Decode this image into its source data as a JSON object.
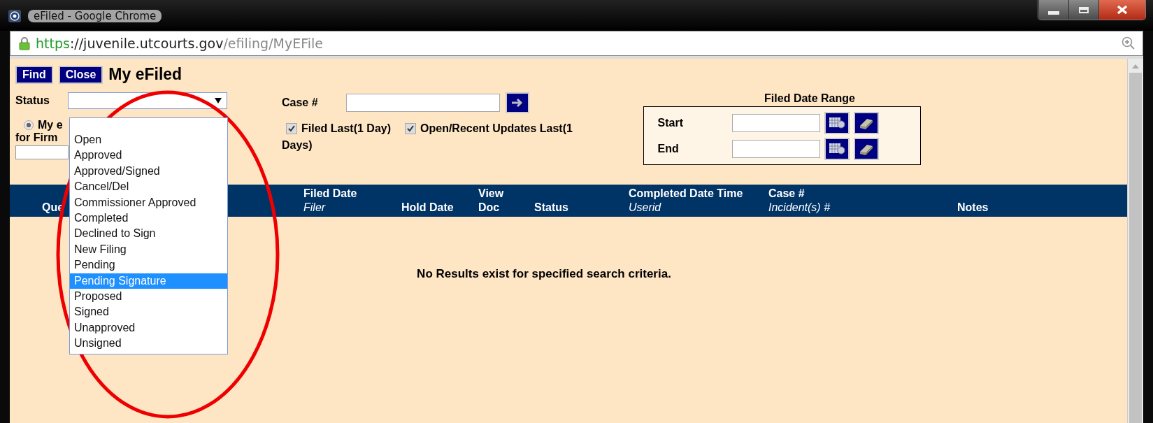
{
  "window": {
    "title": "eFiled - Google Chrome"
  },
  "address_bar": {
    "scheme": "https",
    "host": "://juvenile.utcourts.gov",
    "path": "/efiling/MyEFile"
  },
  "toolbar": {
    "buttons": [
      "Find",
      "Close"
    ],
    "title": "My eFiled"
  },
  "filters": {
    "status_label": "Status",
    "case_label": "Case #",
    "radio": {
      "label": "My e",
      "selected": true
    },
    "firm_label": "for Firm",
    "checkboxes": [
      {
        "label": "Filed Last(1 Day)",
        "checked": true
      },
      {
        "label": "Open/Recent Updates Last(1",
        "checked": true
      }
    ],
    "checkbox_wrap": "Days)",
    "date_range": {
      "title": "Filed Date Range",
      "rows": [
        {
          "label": "Start"
        },
        {
          "label": "End"
        }
      ]
    }
  },
  "status_dropdown": {
    "options": [
      {
        "label": "Open",
        "selected": false
      },
      {
        "label": "Approved",
        "selected": false
      },
      {
        "label": "Approved/Signed",
        "selected": false
      },
      {
        "label": "Cancel/Del",
        "selected": false
      },
      {
        "label": "Commissioner Approved",
        "selected": false
      },
      {
        "label": "Completed",
        "selected": false
      },
      {
        "label": "Declined to Sign",
        "selected": false
      },
      {
        "label": "New Filing",
        "selected": false
      },
      {
        "label": "Pending",
        "selected": false
      },
      {
        "label": "Pending Signature",
        "selected": true
      },
      {
        "label": "Proposed",
        "selected": false
      },
      {
        "label": "Signed",
        "selected": false
      },
      {
        "label": "Unapproved",
        "selected": false
      },
      {
        "label": "Unsigned",
        "selected": false
      }
    ]
  },
  "table": {
    "columns": [
      {
        "line1": "Que"
      },
      {
        "line1": "Filed Date",
        "line2": "Filer"
      },
      {
        "line2": "Hold Date"
      },
      {
        "line1": "View",
        "line2": "Doc"
      },
      {
        "line2": "Status"
      },
      {
        "line1": "Completed Date Time",
        "line2": "Userid"
      },
      {
        "line1": "Case #",
        "line2": "Incident(s) #"
      },
      {
        "line2": "Notes"
      }
    ],
    "empty_message": "No Results exist for specified search criteria."
  },
  "annotation": {
    "kind": "ellipse"
  }
}
